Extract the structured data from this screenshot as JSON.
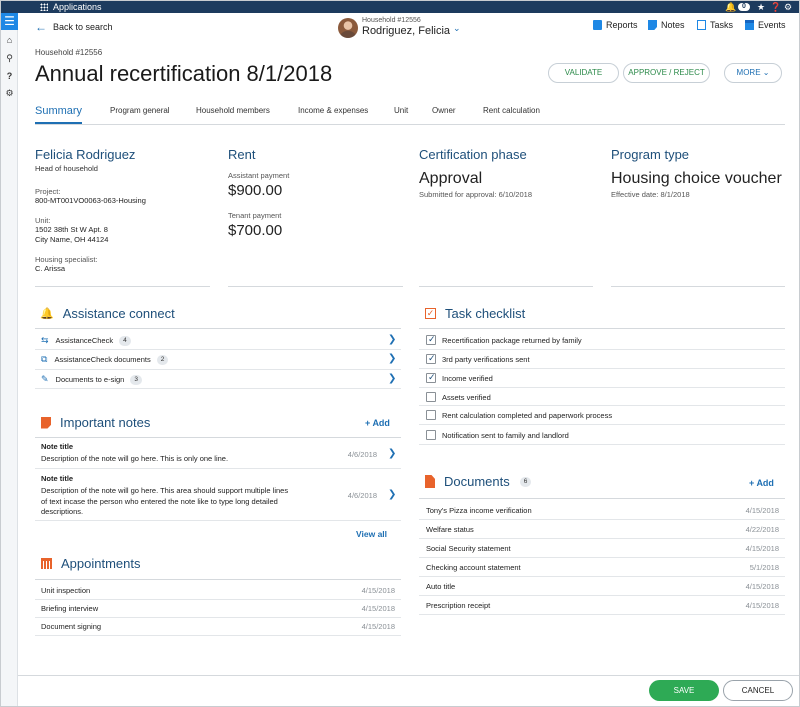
{
  "topbar": {
    "app_label": "Applications",
    "notif_count": "0"
  },
  "header": {
    "back_label": "Back to search",
    "household_id": "Household #12556",
    "household_name": "Rodriguez, Felicia",
    "tools": [
      "Reports",
      "Notes",
      "Tasks",
      "Events"
    ],
    "breadcrumb": "Household #12556",
    "title": "Annual recertification 8/1/2018",
    "validate_label": "VALIDATE",
    "approve_label": "APPROVE / REJECT",
    "more_label": "MORE"
  },
  "tabs": [
    "Summary",
    "Program general",
    "Household members",
    "Income & expenses",
    "Unit",
    "Owner",
    "Rent calculation"
  ],
  "summary": {
    "person": {
      "name": "Felicia Rodriguez",
      "role": "Head of household",
      "project_label": "Project:",
      "project": "800-MT001VO0063-063-Housing",
      "unit_label": "Unit:",
      "unit_line1": "1502 38th St W Apt. 8",
      "unit_line2": "City Name, OH 44124",
      "specialist_label": "Housing specialist:",
      "specialist": "C. Arissa"
    },
    "rent": {
      "title": "Rent",
      "assistant_label": "Assistant payment",
      "assistant_value": "$900.00",
      "tenant_label": "Tenant payment",
      "tenant_value": "$700.00"
    },
    "phase": {
      "title": "Certification phase",
      "value": "Approval",
      "note": "Submitted for approval: 6/10/2018"
    },
    "program": {
      "title": "Program type",
      "value": "Housing choice voucher",
      "note": "Effective date: 8/1/2018"
    }
  },
  "assistance": {
    "title": "Assistance connect",
    "items": [
      {
        "label": "AssistanceCheck",
        "count": "4"
      },
      {
        "label": "AssistanceCheck documents",
        "count": "2"
      },
      {
        "label": "Documents to e-sign",
        "count": "3"
      }
    ]
  },
  "notes": {
    "title": "Important notes",
    "add_label": "Add",
    "items": [
      {
        "title": "Note title",
        "body": "Description of the note will go here. This is only one line.",
        "date": "4/6/2018"
      },
      {
        "title": "Note title",
        "body": "Description of the note will go here. This area should support multiple lines of text incase the person who entered the note like to type long detailed descriptions.",
        "date": "4/6/2018"
      }
    ],
    "view_all": "View all"
  },
  "appointments": {
    "title": "Appointments",
    "items": [
      {
        "label": "Unit inspection",
        "date": "4/15/2018"
      },
      {
        "label": "Briefing interview",
        "date": "4/15/2018"
      },
      {
        "label": "Document signing",
        "date": "4/15/2018"
      }
    ]
  },
  "tasks": {
    "title": "Task checklist",
    "items": [
      {
        "label": "Recertification package returned by family",
        "checked": true
      },
      {
        "label": "3rd party verifications sent",
        "checked": true
      },
      {
        "label": "Income verified",
        "checked": true
      },
      {
        "label": "Assets verified",
        "checked": false
      },
      {
        "label": "Rent calculation completed and paperwork process",
        "checked": false
      },
      {
        "label": "Notification sent to family and landlord",
        "checked": false
      }
    ]
  },
  "documents": {
    "title": "Documents",
    "count": "6",
    "add_label": "Add",
    "items": [
      {
        "label": "Tony's Pizza income verification",
        "date": "4/15/2018"
      },
      {
        "label": "Welfare status",
        "date": "4/22/2018"
      },
      {
        "label": "Social Security statement",
        "date": "4/15/2018"
      },
      {
        "label": "Checking account statement",
        "date": "5/1/2018"
      },
      {
        "label": "Auto title",
        "date": "4/15/2018"
      },
      {
        "label": "Prescription receipt",
        "date": "4/15/2018"
      }
    ]
  },
  "footer": {
    "save_label": "SAVE",
    "cancel_label": "CANCEL"
  }
}
